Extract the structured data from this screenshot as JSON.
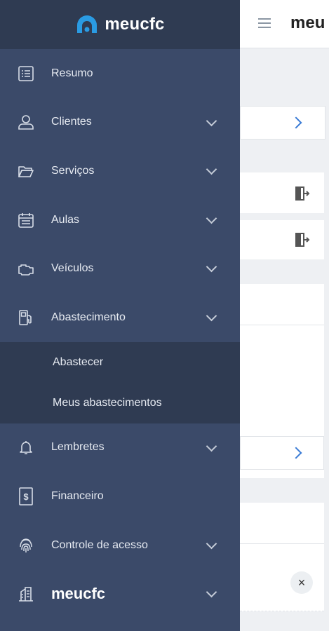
{
  "drawer": {
    "brand": "meucfc",
    "items": [
      {
        "label": "Resumo",
        "icon": "list-icon",
        "expandable": false
      },
      {
        "label": "Clientes",
        "icon": "user-icon",
        "expandable": true
      },
      {
        "label": "Serviços",
        "icon": "folder-icon",
        "expandable": true
      },
      {
        "label": "Aulas",
        "icon": "calendar-icon",
        "expandable": true
      },
      {
        "label": "Veículos",
        "icon": "engine-icon",
        "expandable": true
      },
      {
        "label": "Abastecimento",
        "icon": "fuel-pump-icon",
        "expandable": true,
        "expanded": true
      }
    ],
    "submenu": [
      "Abastecer",
      "Meus abastecimentos"
    ],
    "items_after": [
      {
        "label": "Lembretes",
        "icon": "bell-icon",
        "expandable": true
      },
      {
        "label": "Financeiro",
        "icon": "receipt-dollar-icon",
        "expandable": false
      },
      {
        "label": "Controle de acesso",
        "icon": "fingerprint-icon",
        "expandable": true
      },
      {
        "label": "meucfc",
        "icon": "building-icon",
        "expandable": true
      }
    ]
  },
  "app": {
    "title": "meu",
    "close_symbol": "×"
  },
  "colors": {
    "drawer_bg": "#3b4a69",
    "drawer_header_bg": "#2f3b52",
    "brand_accent": "#2a9be3",
    "link_accent": "#3a7bd5"
  }
}
